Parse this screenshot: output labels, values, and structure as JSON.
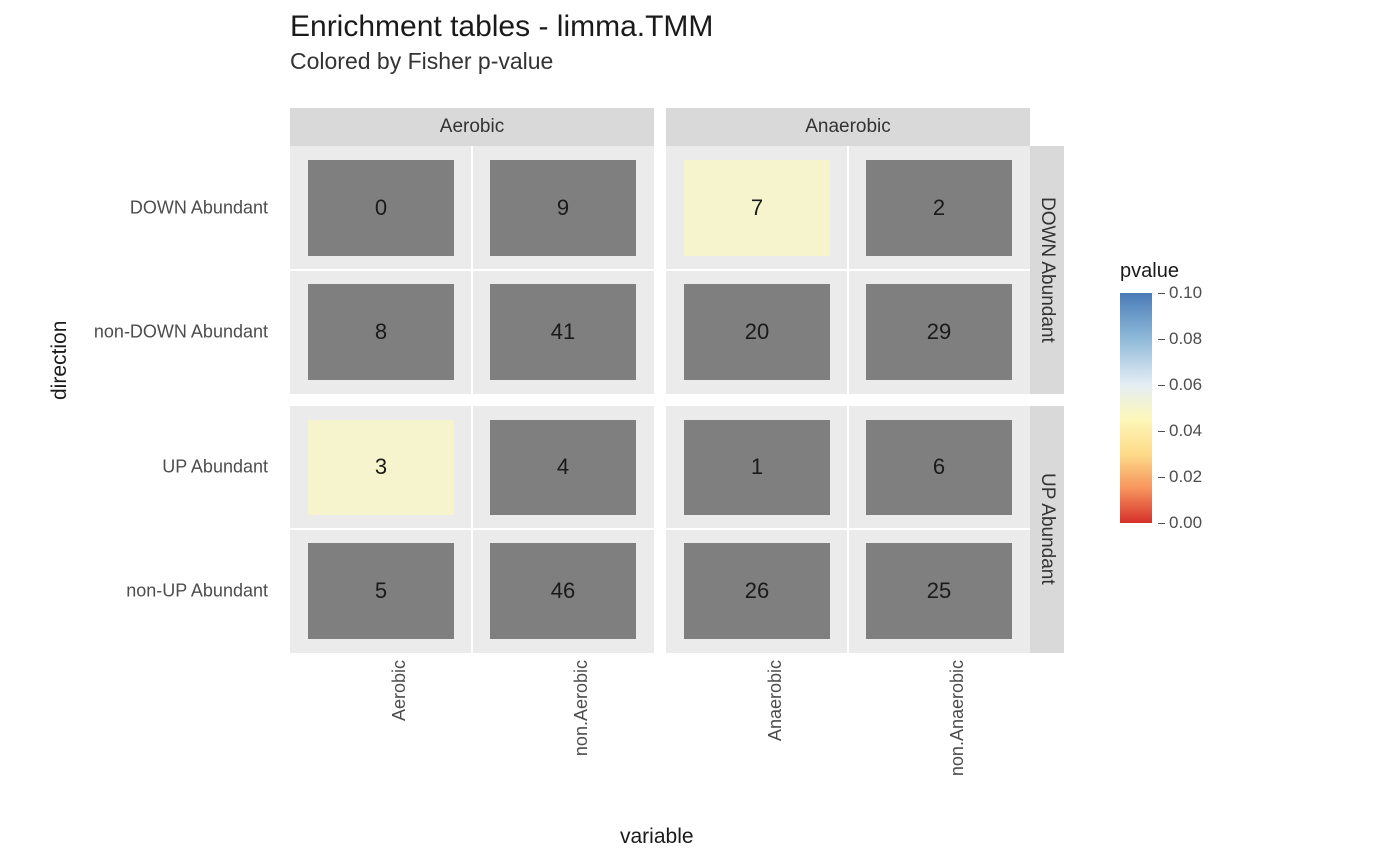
{
  "chart_data": {
    "type": "heatmap",
    "title": "Enrichment tables - limma.TMM",
    "subtitle": "Colored by Fisher p-value",
    "xlabel": "variable",
    "ylabel": "direction",
    "facet_cols": [
      "Aerobic",
      "Anaerobic"
    ],
    "facet_rows": [
      "DOWN Abundant",
      "UP Abundant"
    ],
    "x_by_col": {
      "Aerobic": [
        "Aerobic",
        "non.Aerobic"
      ],
      "Anaerobic": [
        "Anaerobic",
        "non.Anaerobic"
      ]
    },
    "y_by_row": {
      "DOWN Abundant": [
        "DOWN Abundant",
        "non-DOWN Abundant"
      ],
      "UP Abundant": [
        "UP Abundant",
        "non-UP Abundant"
      ]
    },
    "cells": [
      {
        "frow": "DOWN Abundant",
        "fcol": "Aerobic",
        "y": "DOWN Abundant",
        "x": "Aerobic",
        "value": 0,
        "pvalue": null
      },
      {
        "frow": "DOWN Abundant",
        "fcol": "Aerobic",
        "y": "DOWN Abundant",
        "x": "non.Aerobic",
        "value": 9,
        "pvalue": null
      },
      {
        "frow": "DOWN Abundant",
        "fcol": "Aerobic",
        "y": "non-DOWN Abundant",
        "x": "Aerobic",
        "value": 8,
        "pvalue": null
      },
      {
        "frow": "DOWN Abundant",
        "fcol": "Aerobic",
        "y": "non-DOWN Abundant",
        "x": "non.Aerobic",
        "value": 41,
        "pvalue": null
      },
      {
        "frow": "DOWN Abundant",
        "fcol": "Anaerobic",
        "y": "DOWN Abundant",
        "x": "Anaerobic",
        "value": 7,
        "pvalue": 0.05
      },
      {
        "frow": "DOWN Abundant",
        "fcol": "Anaerobic",
        "y": "DOWN Abundant",
        "x": "non.Anaerobic",
        "value": 2,
        "pvalue": null
      },
      {
        "frow": "DOWN Abundant",
        "fcol": "Anaerobic",
        "y": "non-DOWN Abundant",
        "x": "Anaerobic",
        "value": 20,
        "pvalue": null
      },
      {
        "frow": "DOWN Abundant",
        "fcol": "Anaerobic",
        "y": "non-DOWN Abundant",
        "x": "non.Anaerobic",
        "value": 29,
        "pvalue": null
      },
      {
        "frow": "UP Abundant",
        "fcol": "Aerobic",
        "y": "UP Abundant",
        "x": "Aerobic",
        "value": 3,
        "pvalue": 0.05
      },
      {
        "frow": "UP Abundant",
        "fcol": "Aerobic",
        "y": "UP Abundant",
        "x": "non.Aerobic",
        "value": 4,
        "pvalue": null
      },
      {
        "frow": "UP Abundant",
        "fcol": "Aerobic",
        "y": "non-UP Abundant",
        "x": "Aerobic",
        "value": 5,
        "pvalue": null
      },
      {
        "frow": "UP Abundant",
        "fcol": "Aerobic",
        "y": "non-UP Abundant",
        "x": "non.Aerobic",
        "value": 46,
        "pvalue": null
      },
      {
        "frow": "UP Abundant",
        "fcol": "Anaerobic",
        "y": "UP Abundant",
        "x": "Anaerobic",
        "value": 1,
        "pvalue": null
      },
      {
        "frow": "UP Abundant",
        "fcol": "Anaerobic",
        "y": "UP Abundant",
        "x": "non.Anaerobic",
        "value": 6,
        "pvalue": null
      },
      {
        "frow": "UP Abundant",
        "fcol": "Anaerobic",
        "y": "non-UP Abundant",
        "x": "Anaerobic",
        "value": 26,
        "pvalue": null
      },
      {
        "frow": "UP Abundant",
        "fcol": "Anaerobic",
        "y": "non-UP Abundant",
        "x": "non.Anaerobic",
        "value": 25,
        "pvalue": null
      }
    ],
    "legend": {
      "title": "pvalue",
      "limits": [
        0.0,
        0.1
      ],
      "ticks": [
        0.1,
        0.08,
        0.06,
        0.04,
        0.02,
        0.0
      ],
      "tick_labels": [
        "0.10",
        "0.08",
        "0.06",
        "0.04",
        "0.02",
        "0.00"
      ]
    },
    "na_color": "#7f7f7f"
  }
}
